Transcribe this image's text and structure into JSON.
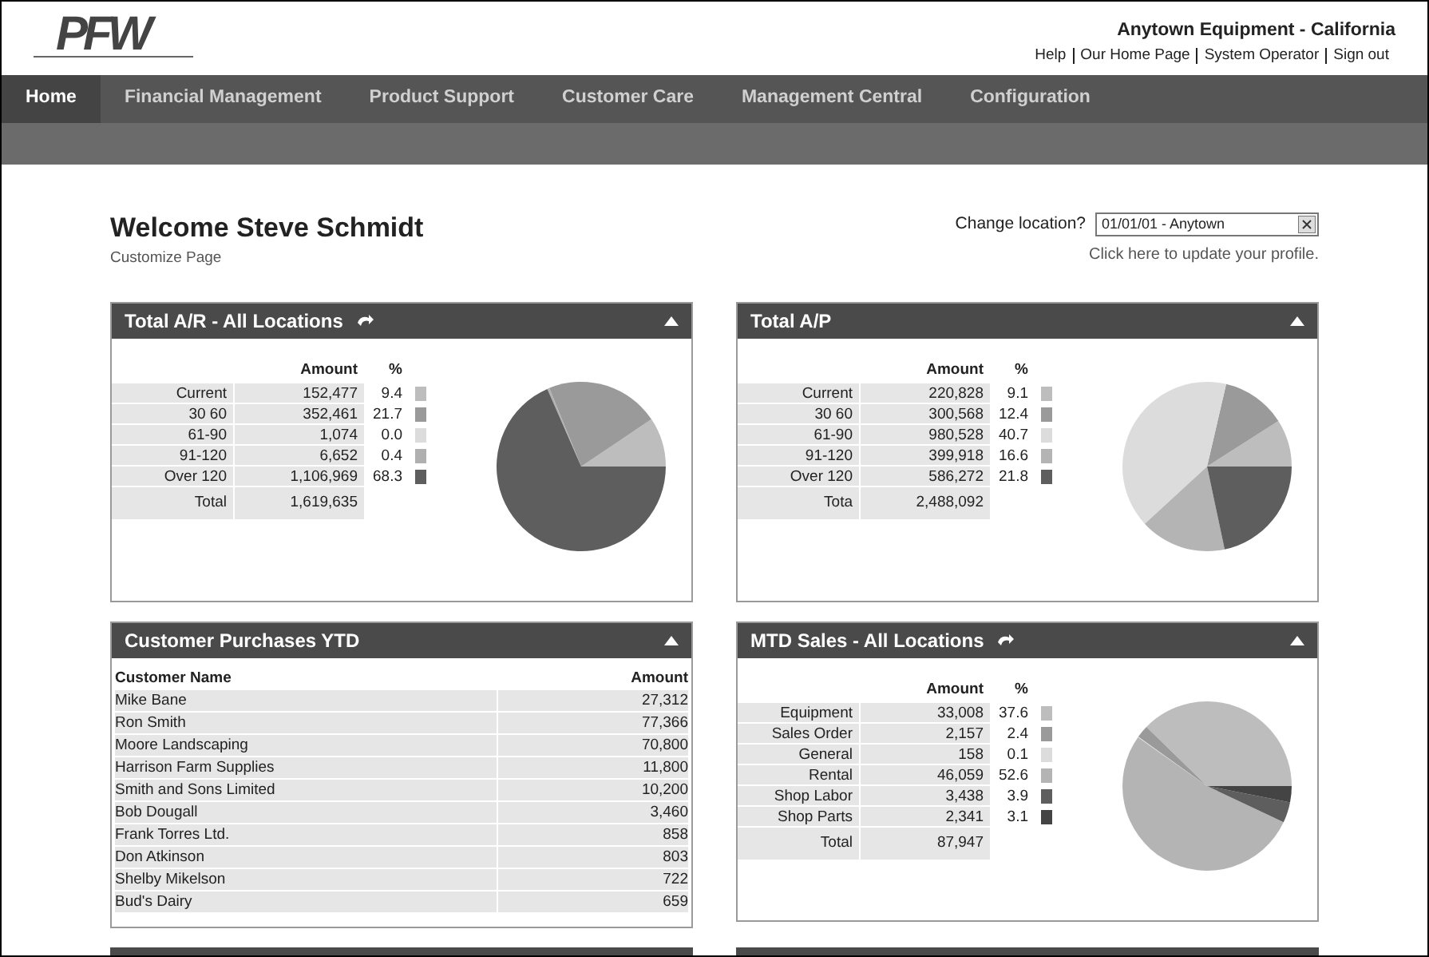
{
  "header": {
    "logo": "PFW",
    "company": "Anytown Equipment - California",
    "links": [
      "Help",
      "Our Home Page",
      "System Operator",
      "Sign out"
    ]
  },
  "nav": {
    "tabs": [
      {
        "label": "Home",
        "selected": true
      },
      {
        "label": "Financial Management",
        "selected": false
      },
      {
        "label": "Product Support",
        "selected": false
      },
      {
        "label": "Customer Care",
        "selected": false
      },
      {
        "label": "Management Central",
        "selected": false
      },
      {
        "label": "Configuration",
        "selected": false
      }
    ]
  },
  "welcome": {
    "title": "Welcome Steve Schmidt",
    "customize": "Customize Page",
    "location_label": "Change location?",
    "location_value": "01/01/01 - Anytown",
    "profile_link": "Click here to update your profile."
  },
  "panels": [
    {
      "kind": "pie",
      "title": "Total A/R - All Locations",
      "refresh": true,
      "columns": [
        "Amount",
        "%"
      ],
      "rows": [
        {
          "amount": "152,477",
          "pct": "9.4",
          "color": "#bdbdbd"
        },
        {
          "amount": "352,461",
          "pct": "21.7",
          "color": "#9a9a9a"
        },
        {
          "amount": "1,074",
          "pct": "0.0",
          "color": "#dcdcdc"
        },
        {
          "amount": "6,652",
          "pct": "0.4",
          "color": "#b0b0b0"
        },
        {
          "amount": "1,106,969",
          "pct": "68.3",
          "color": "#5e5e5e"
        }
      ],
      "total": {
        "label": "Total",
        "amount": "1,619,635"
      },
      "chart_data": {
        "type": "pie",
        "categories": [
          "Current",
          "30 60",
          "61-90",
          "91-120",
          "Over 120"
        ],
        "values": [
          9.4,
          21.7,
          0.0,
          0.4,
          68.3
        ]
      }
    },
    {
      "kind": "pie",
      "title": "Total A/P",
      "refresh": false,
      "columns": [
        "Amount",
        "%"
      ],
      "rows": [
        {
          "amount": "220,828",
          "pct": "9.1",
          "color": "#bdbdbd"
        },
        {
          "amount": "300,568",
          "pct": "12.4",
          "color": "#9a9a9a"
        },
        {
          "amount": "980,528",
          "pct": "40.7",
          "color": "#dcdcdc"
        },
        {
          "amount": "399,918",
          "pct": "16.6",
          "color": "#b4b4b4"
        },
        {
          "amount": "586,272",
          "pct": "21.8",
          "color": "#5e5e5e"
        }
      ],
      "total": {
        "label": "Tota",
        "amount": "2,488,092"
      },
      "chart_data": {
        "type": "pie",
        "categories": [
          "Current",
          "30 60",
          "61-90",
          "91-120",
          "Over 120"
        ],
        "values": [
          9.1,
          12.4,
          40.7,
          16.6,
          21.8
        ]
      }
    },
    {
      "kind": "table",
      "title": "Customer Purchases YTD",
      "refresh": false,
      "columns": [
        "Customer Name",
        "Amount"
      ],
      "rows": [
        {
          "name": "Mike Bane",
          "amount": "27,312"
        },
        {
          "name": "Ron Smith",
          "amount": "77,366"
        },
        {
          "name": "Moore Landscaping",
          "amount": "70,800"
        },
        {
          "name": "Harrison Farm Supplies",
          "amount": "11,800"
        },
        {
          "name": "Smith and Sons Limited",
          "amount": "10,200"
        },
        {
          "name": "Bob Dougall",
          "amount": "3,460"
        },
        {
          "name": "Frank Torres Ltd.",
          "amount": "858"
        },
        {
          "name": "Don Atkinson",
          "amount": "803"
        },
        {
          "name": "Shelby Mikelson",
          "amount": "722"
        },
        {
          "name": "Bud's Dairy",
          "amount": "659"
        }
      ]
    },
    {
      "kind": "pie",
      "title": "MTD Sales - All Locations",
      "refresh": true,
      "columns": [
        "Amount",
        "%"
      ],
      "rows": [
        {
          "amount": "33,008",
          "pct": "37.6",
          "color": "#bdbdbd"
        },
        {
          "amount": "2,157",
          "pct": "2.4",
          "color": "#9a9a9a"
        },
        {
          "amount": "158",
          "pct": "0.1",
          "color": "#dcdcdc"
        },
        {
          "amount": "46,059",
          "pct": "52.6",
          "color": "#b4b4b4"
        },
        {
          "amount": "3,438",
          "pct": "3.9",
          "color": "#5e5e5e"
        },
        {
          "amount": "2,341",
          "pct": "3.1",
          "color": "#444444"
        }
      ],
      "total": {
        "label": "Total",
        "amount": "87,947"
      },
      "chart_data": {
        "type": "pie",
        "categories": [
          "Equipment",
          "Sales Order",
          "General",
          "Rental",
          "Shop Labor",
          "Shop Parts"
        ],
        "values": [
          37.6,
          2.4,
          0.1,
          52.6,
          3.9,
          3.1
        ]
      }
    }
  ]
}
